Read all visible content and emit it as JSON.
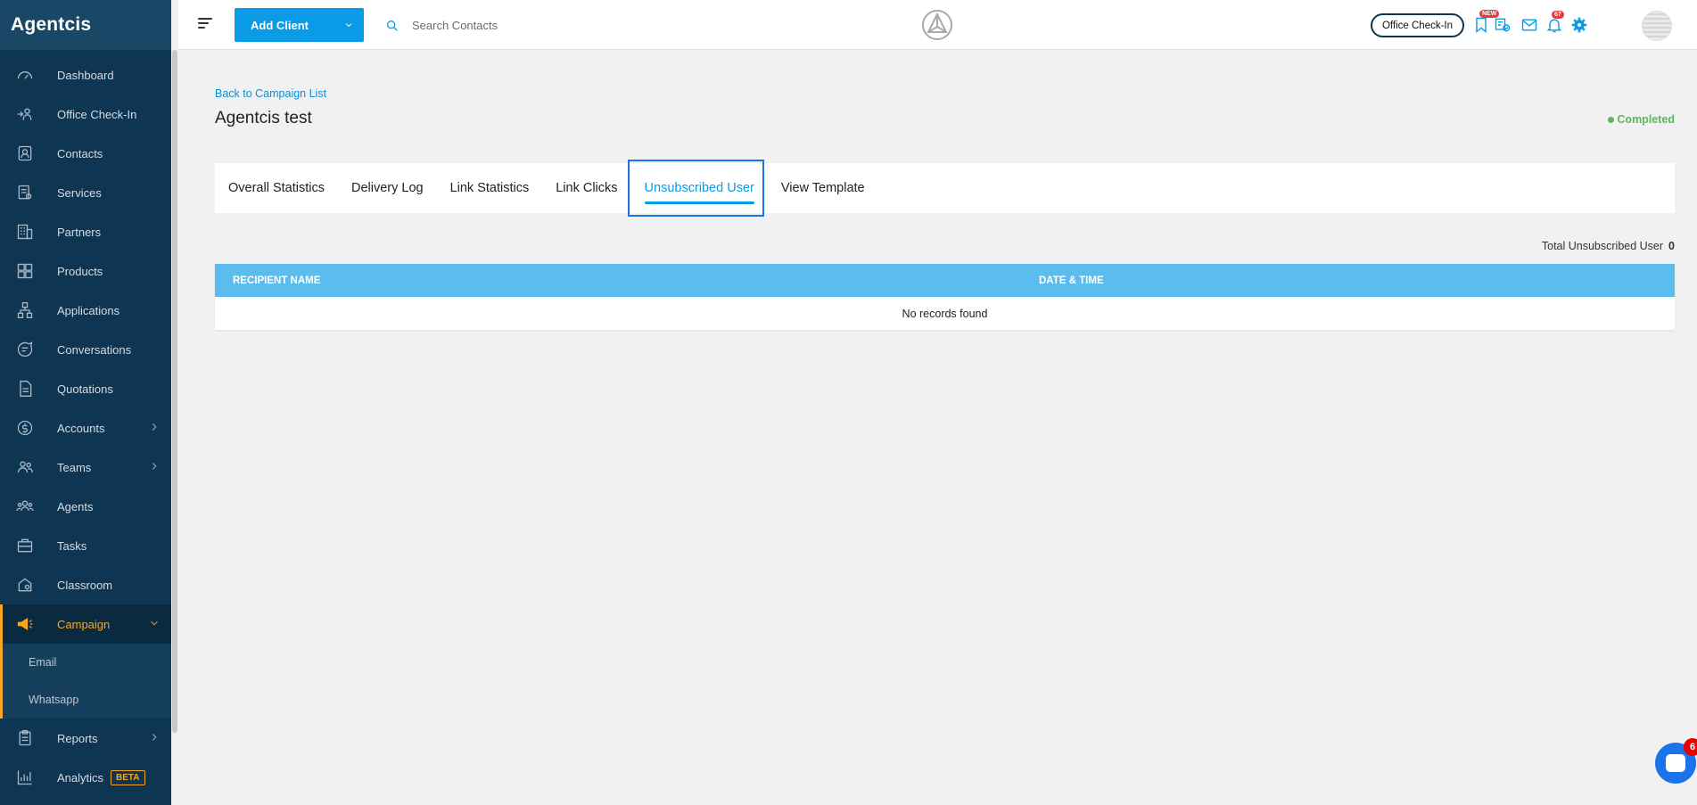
{
  "app": {
    "brand": "Agentcis"
  },
  "sidebar": {
    "items": [
      {
        "label": "Dashboard",
        "icon": "dashboard-icon"
      },
      {
        "label": "Office Check-In",
        "icon": "checkin-icon"
      },
      {
        "label": "Contacts",
        "icon": "contacts-icon"
      },
      {
        "label": "Services",
        "icon": "services-icon"
      },
      {
        "label": "Partners",
        "icon": "partners-icon"
      },
      {
        "label": "Products",
        "icon": "products-icon"
      },
      {
        "label": "Applications",
        "icon": "applications-icon"
      },
      {
        "label": "Conversations",
        "icon": "conversations-icon"
      },
      {
        "label": "Quotations",
        "icon": "quotations-icon"
      },
      {
        "label": "Accounts",
        "icon": "accounts-icon"
      },
      {
        "label": "Teams",
        "icon": "teams-icon"
      },
      {
        "label": "Agents",
        "icon": "agents-icon"
      },
      {
        "label": "Tasks",
        "icon": "tasks-icon"
      },
      {
        "label": "Classroom",
        "icon": "classroom-icon"
      },
      {
        "label": "Campaign",
        "icon": "megaphone-icon"
      }
    ],
    "campaign_sub": [
      {
        "label": "Email"
      },
      {
        "label": "Whatsapp"
      }
    ],
    "after": [
      {
        "label": "Reports",
        "icon": "reports-icon"
      },
      {
        "label": "Analytics",
        "icon": "analytics-icon",
        "badge": "BETA"
      }
    ]
  },
  "topbar": {
    "add_client": "Add Client",
    "search_placeholder": "Search Contacts",
    "office_checkin": "Office Check-In",
    "new_badge": "NEW",
    "notifications_count": "67"
  },
  "page": {
    "back_link": "Back to Campaign List",
    "title": "Agentcis test",
    "status": "Completed",
    "status_color": "#5cb85c",
    "tabs": [
      {
        "label": "Overall Statistics"
      },
      {
        "label": "Delivery Log"
      },
      {
        "label": "Link Statistics"
      },
      {
        "label": "Link Clicks"
      },
      {
        "label": "Unsubscribed User",
        "active": true
      },
      {
        "label": "View Template"
      }
    ],
    "total_label": "Total Unsubscribed User",
    "total_value": "0",
    "table": {
      "columns": [
        "RECIPIENT NAME",
        "DATE & TIME"
      ],
      "empty_text": "No records found"
    }
  },
  "chat": {
    "badge": "6"
  },
  "colors": {
    "accent": "#0a9be6",
    "sidebar_bg": "#0e3551",
    "active": "#f5a623",
    "table_header": "#5bbdee"
  }
}
